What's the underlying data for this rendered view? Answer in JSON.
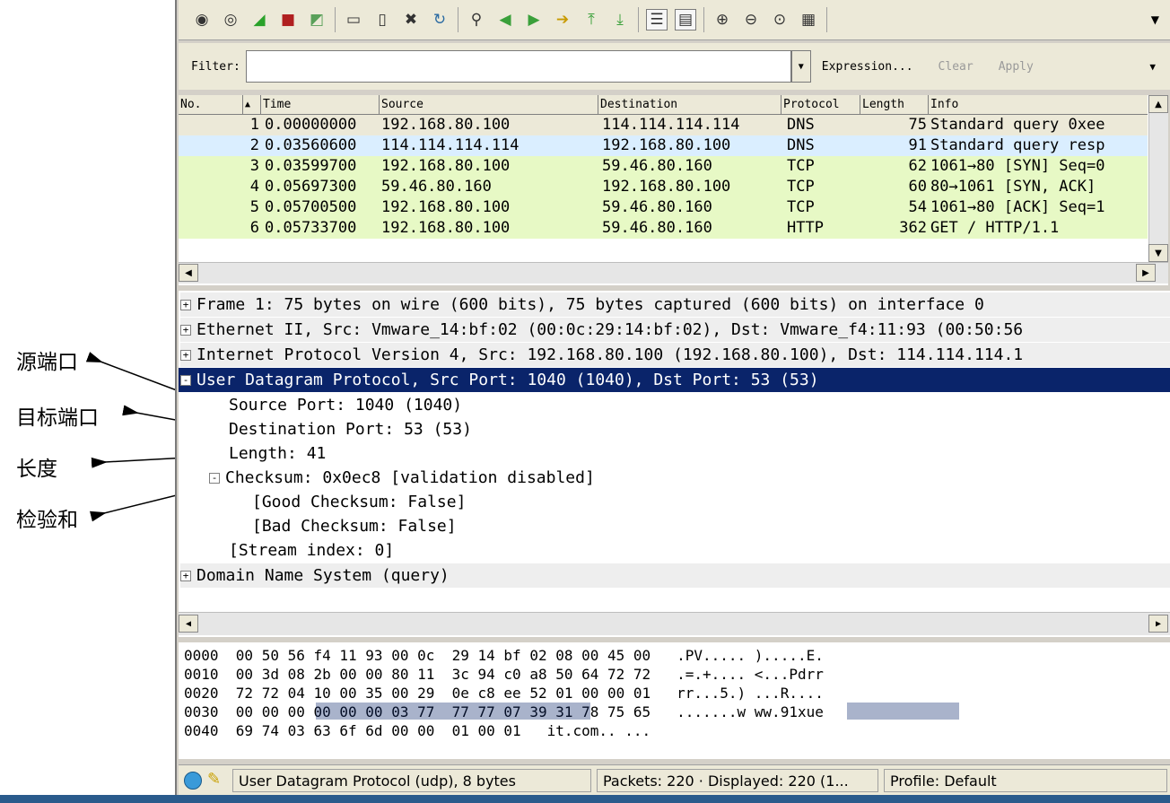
{
  "annotations": [
    {
      "label": "源端口"
    },
    {
      "label": "目标端口"
    },
    {
      "label": "长度"
    },
    {
      "label": "检验和"
    }
  ],
  "toolbar": {
    "icons": [
      "interface-list-icon",
      "capture-options-icon",
      "start-capture-icon",
      "stop-capture-icon",
      "restart-capture-icon",
      "open-file-icon",
      "save-file-icon",
      "close-file-icon",
      "reload-icon",
      "find-icon",
      "go-back-icon",
      "go-forward-icon",
      "go-to-packet-icon",
      "first-packet-icon",
      "last-packet-icon",
      "colorize-icon",
      "autoscroll-icon",
      "zoom-in-icon",
      "zoom-out-icon",
      "normal-size-icon",
      "resize-columns-icon"
    ]
  },
  "filter": {
    "label": "Filter:",
    "value": "",
    "expression": "Expression...",
    "clear": "Clear",
    "apply": "Apply"
  },
  "packet_list": {
    "columns": [
      "No.",
      "Time",
      "Source",
      "Destination",
      "Protocol",
      "Length",
      "Info"
    ],
    "rows": [
      {
        "no": "1",
        "time": "0.00000000",
        "src": "192.168.80.100",
        "dst": "114.114.114.114",
        "proto": "DNS",
        "len": "75",
        "info": "Standard query 0xee",
        "bg": "#ece9d8"
      },
      {
        "no": "2",
        "time": "0.03560600",
        "src": "114.114.114.114",
        "dst": "192.168.80.100",
        "proto": "DNS",
        "len": "91",
        "info": "Standard query resp",
        "bg": "#daeeff"
      },
      {
        "no": "3",
        "time": "0.03599700",
        "src": "192.168.80.100",
        "dst": "59.46.80.160",
        "proto": "TCP",
        "len": "62",
        "info": "1061→80 [SYN] Seq=0",
        "bg": "#e7f9c5"
      },
      {
        "no": "4",
        "time": "0.05697300",
        "src": "59.46.80.160",
        "dst": "192.168.80.100",
        "proto": "TCP",
        "len": "60",
        "info": "80→1061 [SYN, ACK]",
        "bg": "#e7f9c5"
      },
      {
        "no": "5",
        "time": "0.05700500",
        "src": "192.168.80.100",
        "dst": "59.46.80.160",
        "proto": "TCP",
        "len": "54",
        "info": "1061→80 [ACK] Seq=1",
        "bg": "#e7f9c5"
      },
      {
        "no": "6",
        "time": "0.05733700",
        "src": "192.168.80.100",
        "dst": "59.46.80.160",
        "proto": "HTTP",
        "len": "362",
        "info": "GET / HTTP/1.1",
        "bg": "#e7f9c5"
      }
    ]
  },
  "detail_tree": {
    "lines": [
      {
        "indent": 0,
        "expander": "+",
        "text": "Frame 1: 75 bytes on wire (600 bits), 75 bytes captured (600 bits) on interface 0",
        "style": "grey"
      },
      {
        "indent": 0,
        "expander": "+",
        "text": "Ethernet II, Src: Vmware_14:bf:02 (00:0c:29:14:bf:02), Dst: Vmware_f4:11:93 (00:50:56",
        "style": "grey"
      },
      {
        "indent": 0,
        "expander": "+",
        "text": "Internet Protocol Version 4, Src: 192.168.80.100 (192.168.80.100), Dst: 114.114.114.1",
        "style": "grey"
      },
      {
        "indent": 0,
        "expander": "-",
        "text": "User Datagram Protocol, Src Port: 1040 (1040), Dst Port: 53 (53)",
        "style": "sel"
      },
      {
        "indent": 1,
        "expander": "",
        "text": "Source Port: 1040 (1040)",
        "style": ""
      },
      {
        "indent": 1,
        "expander": "",
        "text": "Destination Port: 53 (53)",
        "style": ""
      },
      {
        "indent": 1,
        "expander": "",
        "text": "Length: 41",
        "style": ""
      },
      {
        "indent": 1,
        "expander": "-",
        "text": "Checksum: 0x0ec8 [validation disabled]",
        "style": ""
      },
      {
        "indent": 2,
        "expander": "",
        "text": "[Good Checksum: False]",
        "style": ""
      },
      {
        "indent": 2,
        "expander": "",
        "text": "[Bad Checksum: False]",
        "style": ""
      },
      {
        "indent": 1,
        "expander": "",
        "text": "[Stream index: 0]",
        "style": ""
      },
      {
        "indent": 0,
        "expander": "+",
        "text": "Domain Name System (query)",
        "style": "grey"
      }
    ]
  },
  "hex": {
    "lines": [
      {
        "offset": "0000",
        "bytes_a": "00 50 56 f4 11 93 00 0c",
        "bytes_b": "29 14 bf 02 08 00 45 00",
        "ascii": ".PV..... ).....E."
      },
      {
        "offset": "0010",
        "bytes_a": "00 3d 08 2b 00 00 80 11",
        "bytes_b": "3c 94 c0 a8 50 64 72 72",
        "ascii": ".=.+.... <...Pdrr"
      },
      {
        "offset": "0020",
        "bytes_a": "72 72 04 10 00 35 00 29",
        "bytes_b": "0e c8 ee 52 01 00 00 01",
        "ascii": "rr...5.) ...R...."
      },
      {
        "offset": "0030",
        "bytes_a": "00 00 00 00 00 00 03 77",
        "bytes_b": "77 77 07 39 31 78 75 65",
        "ascii": ".......w ww.91xue"
      },
      {
        "offset": "0040",
        "bytes_a": "69 74 03 63 6f 6d 00 00",
        "bytes_b": "01 00 01",
        "ascii": "it.com.. ..."
      }
    ]
  },
  "status": {
    "protocol": "User Datagram Protocol (udp), 8 bytes",
    "packets": "Packets: 220 · Displayed: 220 (1...",
    "profile": "Profile: Default"
  },
  "colors": {
    "selection": "#0a246a",
    "dns_row": "#ece9d8",
    "dns_resp_row": "#daeeff",
    "tcp_row": "#e7f9c5"
  }
}
